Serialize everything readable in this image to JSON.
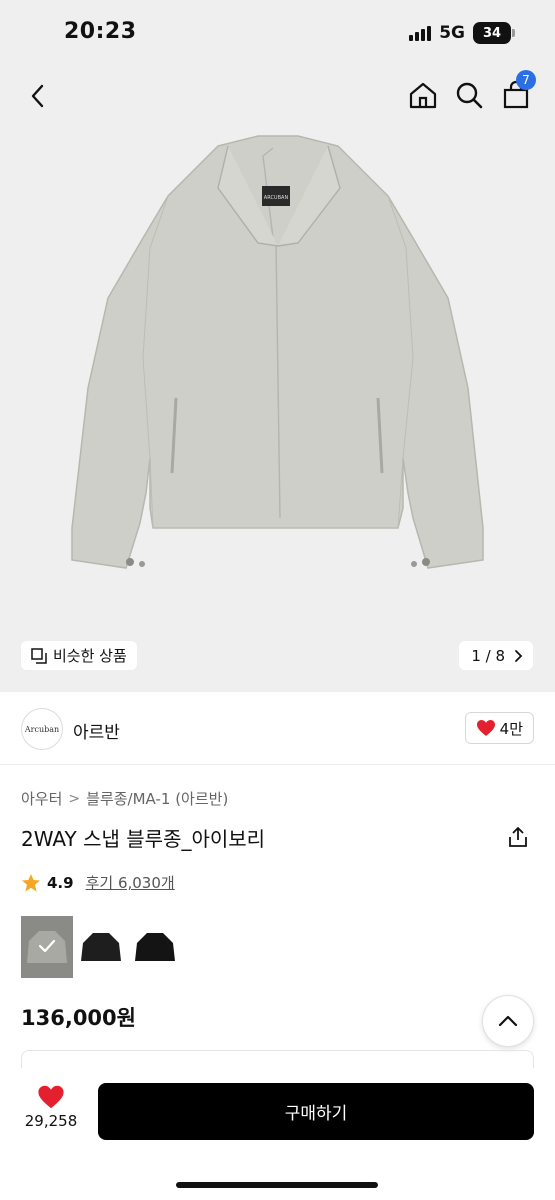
{
  "status_bar": {
    "time": "20:23",
    "network": "5G",
    "battery": "34"
  },
  "header": {
    "cart_count": "7"
  },
  "gallery": {
    "similar_label": "비슷한 상품",
    "pager_text": "1 / 8",
    "jacket_tag": "ARCUBAN"
  },
  "brand": {
    "logo_text": "Arcuban",
    "name": "아르반",
    "likes": "4만"
  },
  "product": {
    "breadcrumb": [
      "아우터",
      "블루종/MA-1 (아르반)"
    ],
    "title": "2WAY 스냅 블루종_아이보리",
    "rating": "4.9",
    "reviews": "후기 6,030개",
    "price": "136,000원"
  },
  "bottom": {
    "wish_count": "29,258",
    "buy_label": "구매하기"
  },
  "colors": {
    "accent_blue": "#2b6fe3",
    "heart_red": "#e5202e",
    "star": "#f5a623",
    "buy_bg": "#000000"
  },
  "icons": [
    "back-icon",
    "home-icon",
    "search-icon",
    "cart-icon",
    "similar-icon",
    "chevron-right-icon",
    "heart-icon",
    "share-icon",
    "star-icon",
    "check-icon",
    "chevron-up-icon"
  ]
}
